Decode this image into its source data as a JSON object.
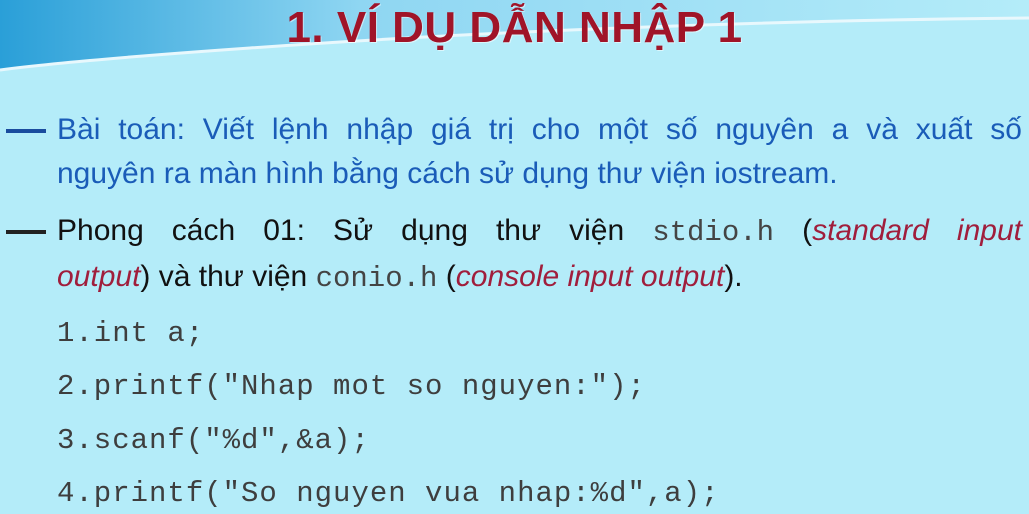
{
  "slide": {
    "title": "1. VÍ DỤ DẪN NHẬP 1",
    "problem": {
      "line1": "Bài toán: Viết lệnh nhập giá trị cho một số nguyên a và xuất số",
      "line2": "nguyên ra màn hình bằng cách sử dụng thư viện iostream."
    },
    "style": {
      "part1": "Phong cách 01: Sử dụng thư viện",
      "lib1": "stdio.h",
      "open_paren": "(",
      "lib1_desc_a": "standard input",
      "lib1_desc_b": "output",
      "part2": ") và thư viện",
      "lib2": "conio.h",
      "open_paren2": "(",
      "lib2_desc": "console input output",
      "close": ")."
    },
    "code_lines": [
      "1.int a;",
      "2.printf(\"Nhap mot so nguyen:\");",
      "3.scanf(\"%d\",&a);",
      "4.printf(\"So nguyen vua nhap:%d\",a);"
    ]
  }
}
